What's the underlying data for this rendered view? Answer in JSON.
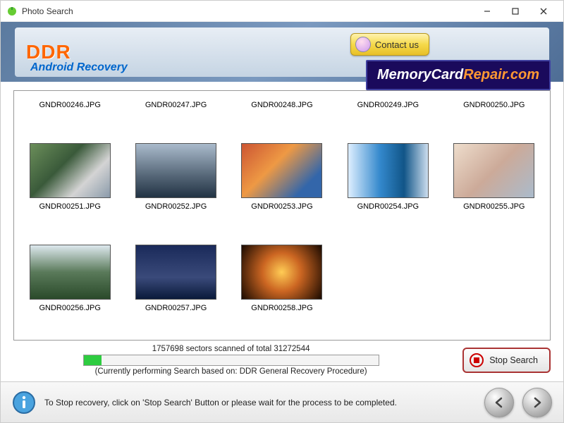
{
  "window": {
    "title": "Photo Search"
  },
  "header": {
    "brand": "DDR",
    "product": "Android Recovery",
    "contact_label": "Contact us",
    "promo_prefix": "MemoryCard",
    "promo_suffix": "Repair.com"
  },
  "thumbs": {
    "row0": [
      "GNDR00246.JPG",
      "GNDR00247.JPG",
      "GNDR00248.JPG",
      "GNDR00249.JPG",
      "GNDR00250.JPG"
    ],
    "row1": [
      "GNDR00251.JPG",
      "GNDR00252.JPG",
      "GNDR00253.JPG",
      "GNDR00254.JPG",
      "GNDR00255.JPG"
    ],
    "row2": [
      "GNDR00256.JPG",
      "GNDR00257.JPG",
      "GNDR00258.JPG"
    ]
  },
  "progress": {
    "status": "1757698 sectors scanned of total 31272544",
    "sub": "(Currently performing Search based on:  DDR General Recovery Procedure)",
    "stop_label": "Stop Search"
  },
  "footer": {
    "hint": "To Stop recovery, click on 'Stop Search' Button or please wait for the process to be completed."
  }
}
